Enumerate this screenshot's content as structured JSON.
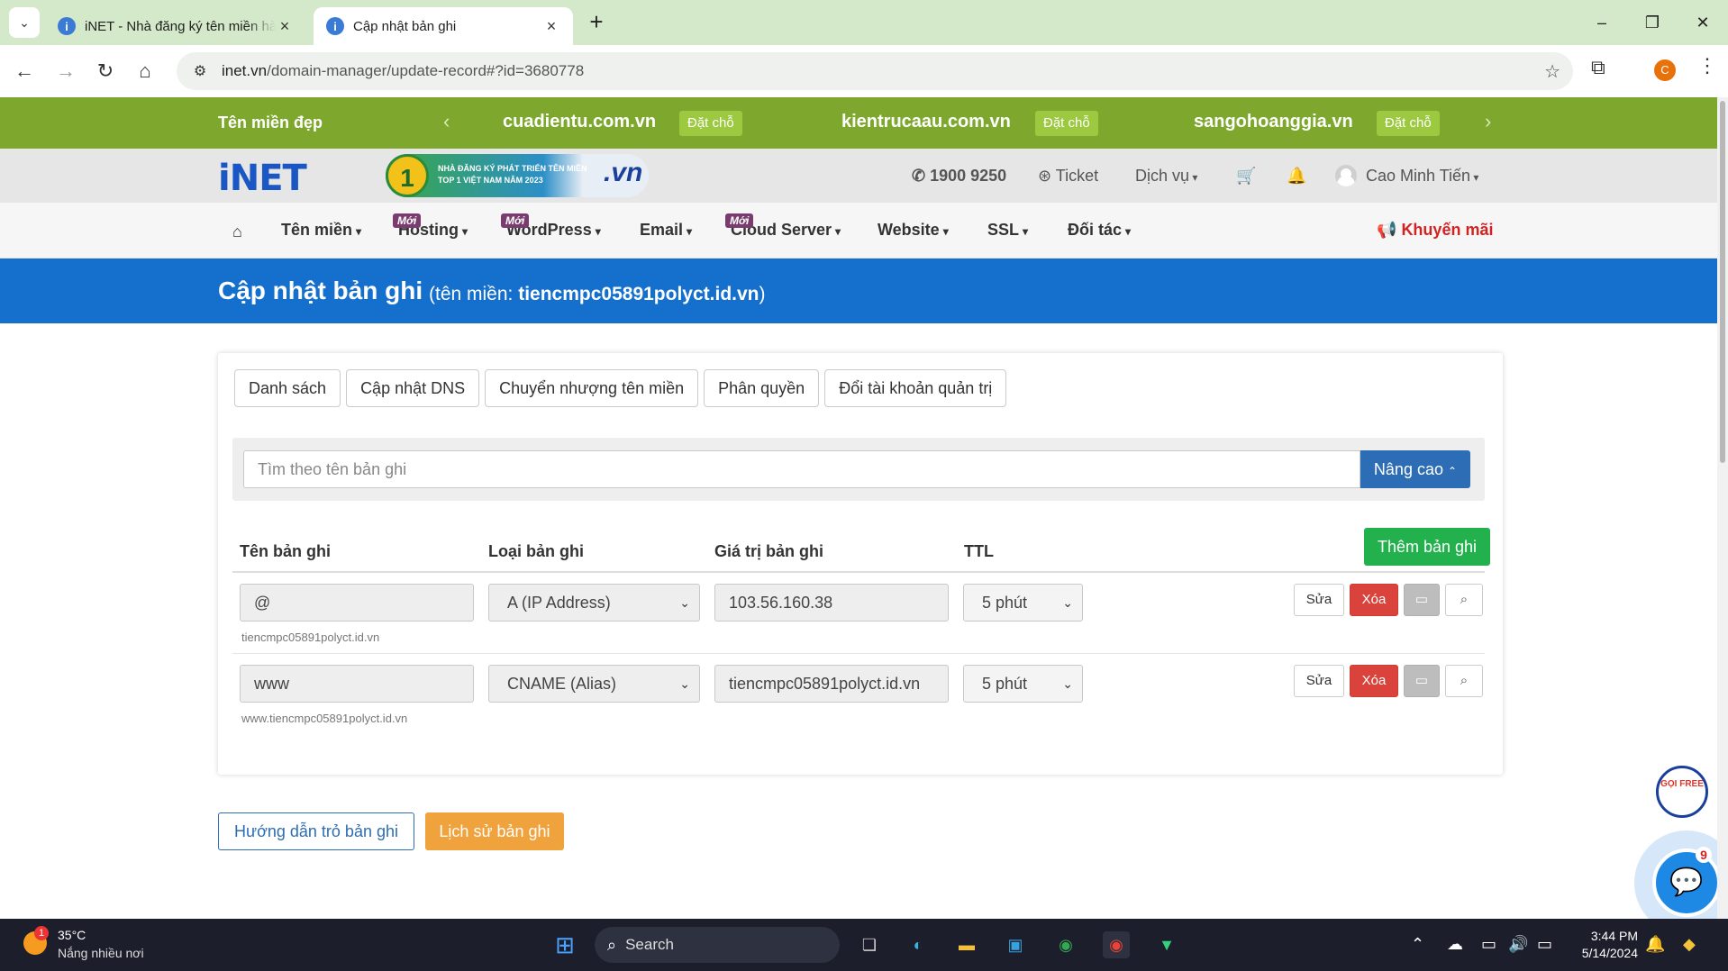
{
  "browser": {
    "tabs": [
      {
        "title": "iNET - Nhà đăng ký tên miền hàng đầu",
        "active": false
      },
      {
        "title": "Cập nhật bản ghi",
        "active": true
      }
    ],
    "url_host": "inet.vn",
    "url_path": "/domain-manager/update-record#?id=3680778",
    "profile_initial": "C"
  },
  "promo_bar": {
    "label": "Tên miền đẹp",
    "domains": [
      {
        "name": "cuadientu.com.vn",
        "action": "Đặt chỗ"
      },
      {
        "name": "kientrucaau.com.vn",
        "action": "Đặt chỗ"
      },
      {
        "name": "sangohoanggia.vn",
        "action": "Đặt chỗ"
      }
    ]
  },
  "header": {
    "logo": "iNET",
    "award_text": "NHÀ ĐĂNG KÝ PHÁT TRIỂN TÊN MIỀN TOP 1 VIỆT NAM NĂM 2023",
    "award_rank": "1",
    "award_brand": ".vn",
    "phone": "1900 9250",
    "ticket": "Ticket",
    "services": "Dịch vụ",
    "user": "Cao Minh Tiến"
  },
  "nav": {
    "items": [
      {
        "label": "Tên miền",
        "badge": ""
      },
      {
        "label": "Hosting",
        "badge": "Mới"
      },
      {
        "label": "WordPress",
        "badge": "Mới"
      },
      {
        "label": "Email",
        "badge": ""
      },
      {
        "label": "Cloud Server",
        "badge": "Mới"
      },
      {
        "label": "Website",
        "badge": ""
      },
      {
        "label": "SSL",
        "badge": ""
      },
      {
        "label": "Đối tác",
        "badge": ""
      }
    ],
    "promo": "Khuyến mãi"
  },
  "title_bar": {
    "title": "Cập nhật bản ghi",
    "domain_prefix": "(tên miền: ",
    "domain": "tiencmpc05891polyct.id.vn",
    "domain_suffix": ")"
  },
  "subtabs": [
    "Danh sách",
    "Cập nhật DNS",
    "Chuyển nhượng tên miền",
    "Phân quyền",
    "Đổi tài khoản quản trị"
  ],
  "search": {
    "placeholder": "Tìm theo tên bản ghi",
    "advanced_label": "Nâng cao"
  },
  "table": {
    "headers": {
      "name": "Tên bản ghi",
      "type": "Loại bản ghi",
      "value": "Giá trị bản ghi",
      "ttl": "TTL"
    },
    "add_label": "Thêm bản ghi",
    "rows": [
      {
        "name": "@",
        "hint": "tiencmpc05891polyct.id.vn",
        "type": "A (IP Address)",
        "value": "103.56.160.38",
        "ttl": "5 phút"
      },
      {
        "name": "www",
        "hint": "www.tiencmpc05891polyct.id.vn",
        "type": "CNAME (Alias)",
        "value": "tiencmpc05891polyct.id.vn",
        "ttl": "5 phút"
      }
    ],
    "actions": {
      "edit": "Sửa",
      "delete": "Xóa"
    }
  },
  "bottom_buttons": {
    "guide": "Hướng dẫn trỏ bản ghi",
    "history": "Lịch sử bản ghi"
  },
  "widgets": {
    "hotline": "GỌI FREE",
    "chat_count": "9"
  },
  "taskbar": {
    "weather_temp": "35°C",
    "weather_desc": "Nắng nhiều nơi",
    "weather_alert": "1",
    "search_label": "Search",
    "time": "3:44 PM",
    "date": "5/14/2024"
  },
  "colors": {
    "promo_green": "#7ea82d",
    "title_blue": "#1470cc",
    "add_green": "#23b14d",
    "delete_red": "#d9433c",
    "history_orange": "#f0a23d"
  }
}
